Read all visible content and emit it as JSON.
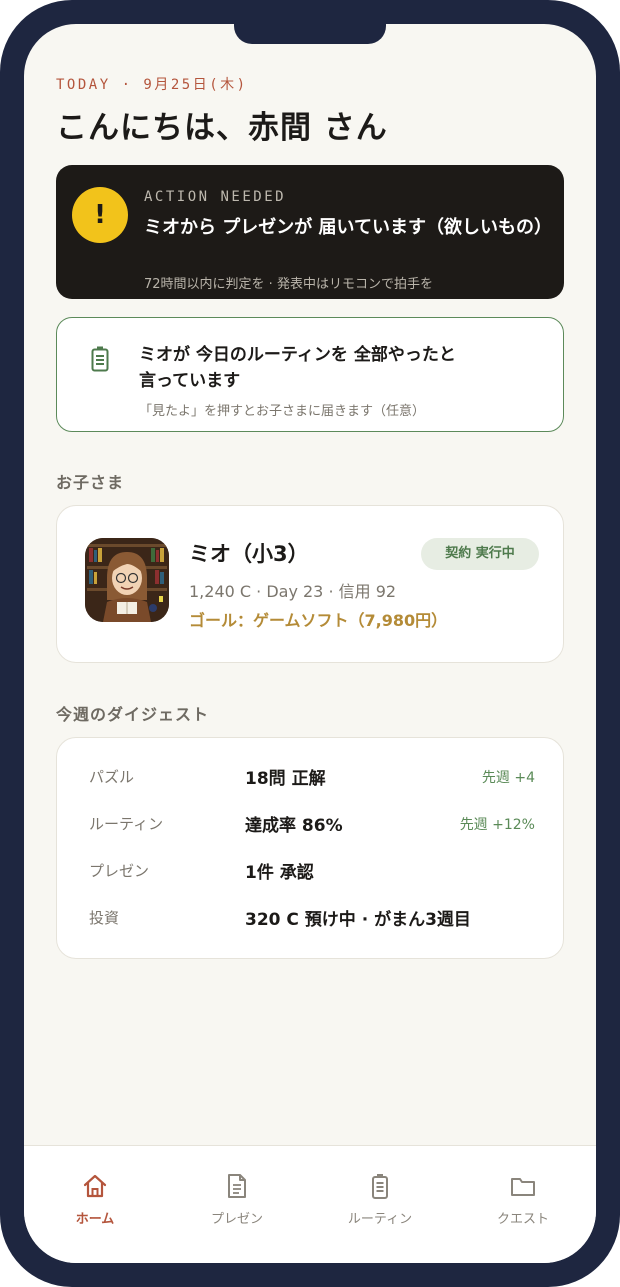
{
  "header": {
    "date_line": "TODAY · 9月25日(木)",
    "greeting": "こんにちは、赤間 さん"
  },
  "action_card": {
    "kicker": "ACTION NEEDED",
    "title": "ミオから プレゼンが 届いています（欲しいもの）",
    "subtitle": "72時間以内に判定を · 発表中はリモコンで拍手を",
    "icon": "exclamation-icon",
    "icon_symbol": "!"
  },
  "routine_card": {
    "title": "ミオが 今日のルーティンを 全部やったと言っています",
    "subtitle": "「見たよ」を押すとお子さまに届きます（任意）",
    "icon": "battery-icon"
  },
  "children_section": {
    "label": "お子さま"
  },
  "child": {
    "name": "ミオ（小3）",
    "badge": "契約 実行中",
    "stats": "1,240 C · Day 23 · 信用 92",
    "goal": "ゴール：ゲームソフト（7,980円）"
  },
  "digest_section": {
    "label": "今週のダイジェスト"
  },
  "digest": [
    {
      "label": "パズル",
      "value": "18問 正解",
      "delta": "先週 +4"
    },
    {
      "label": "ルーティン",
      "value": "達成率 86%",
      "delta": "先週 +12%"
    },
    {
      "label": "プレゼン",
      "value": "1件 承認",
      "delta": ""
    },
    {
      "label": "投資",
      "value": "320 C 預け中 · がまん3週目",
      "delta": ""
    }
  ],
  "tabs": [
    {
      "label": "ホーム",
      "icon": "home-icon",
      "active": true
    },
    {
      "label": "プレゼン",
      "icon": "document-icon",
      "active": false
    },
    {
      "label": "ルーティン",
      "icon": "battery-icon",
      "active": false
    },
    {
      "label": "クエスト",
      "icon": "folder-icon",
      "active": false
    }
  ],
  "colors": {
    "frame": "#1e2640",
    "background": "#f8f7f2",
    "accent": "#b4553c",
    "warning": "#f2c31b",
    "success": "#5a8a57",
    "gold": "#b48b37"
  }
}
